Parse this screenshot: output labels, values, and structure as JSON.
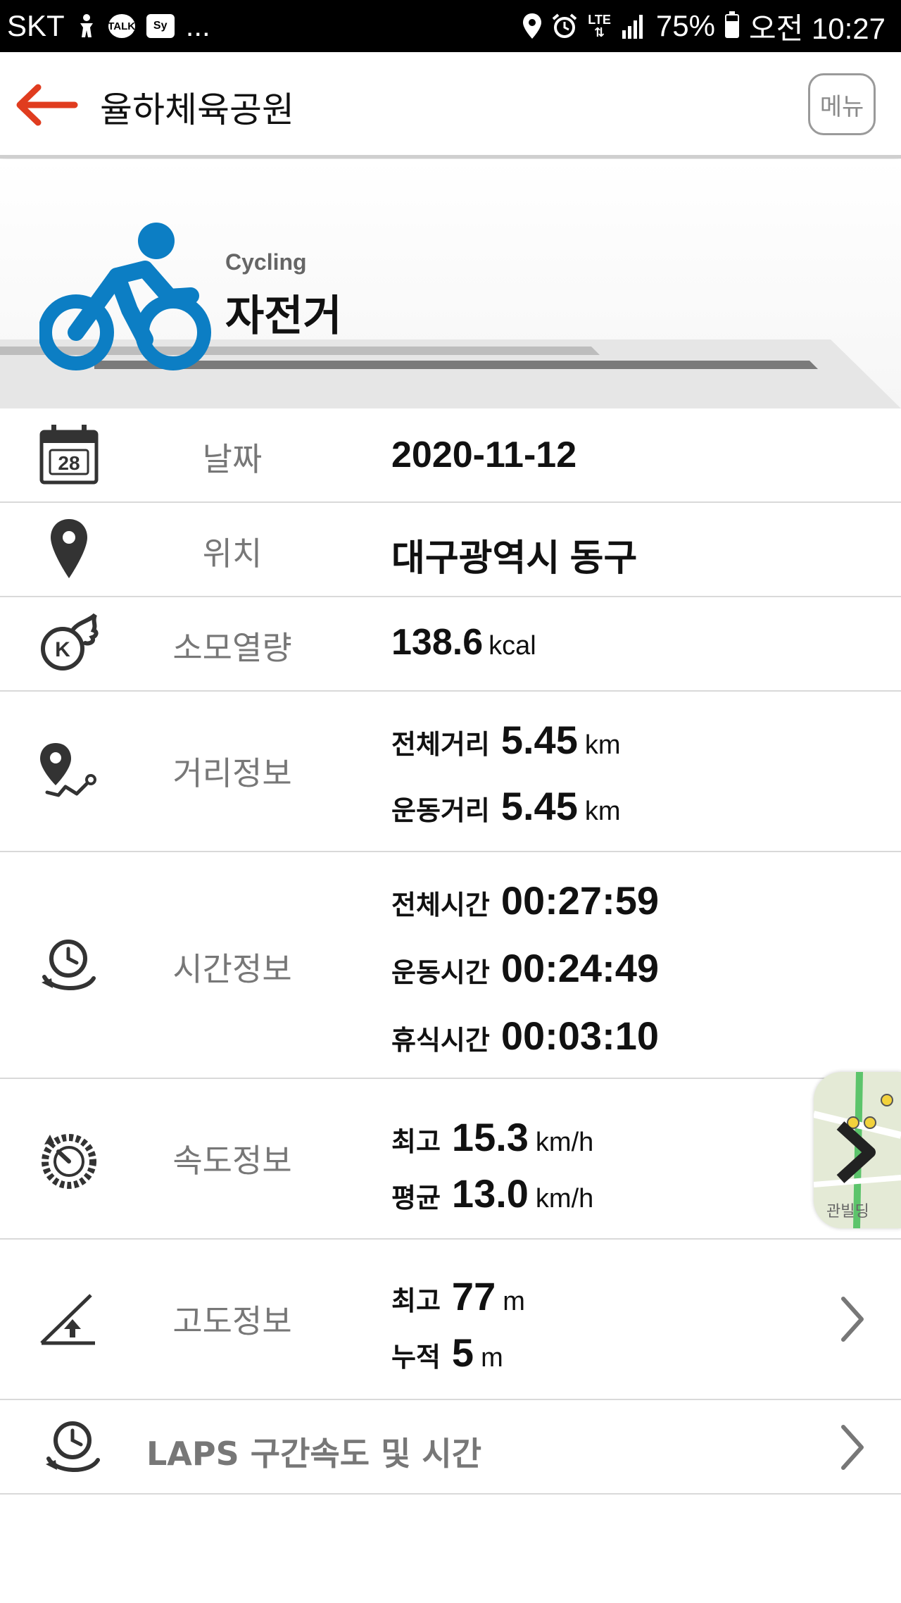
{
  "status_bar": {
    "carrier": "SKT",
    "talk_icon_label": "TALK",
    "sy_icon_label": "Sy",
    "more": "...",
    "network": "LTE",
    "battery": "75%",
    "time": "오전 10:27"
  },
  "header": {
    "title": "율하체육공원",
    "menu_label": "메뉴",
    "accent_color": "#e03c1f"
  },
  "activity": {
    "subtitle": "Cycling",
    "name": "자전거",
    "icon_color": "#0c7ec4"
  },
  "rows": {
    "date": {
      "label": "날짜",
      "value": "2020-11-12",
      "calendar_day": "28"
    },
    "location": {
      "label": "위치",
      "value": "대구광역시 동구"
    },
    "calories": {
      "label": "소모열량",
      "value": "138.6",
      "unit": "kcal",
      "icon_letter": "K"
    },
    "distance": {
      "label": "거리정보",
      "total_label": "전체거리",
      "total_value": "5.45",
      "total_unit": "km",
      "exercise_label": "운동거리",
      "exercise_value": "5.45",
      "exercise_unit": "km"
    },
    "time": {
      "label": "시간정보",
      "total_label": "전체시간",
      "total_value": "00:27:59",
      "exercise_label": "운동시간",
      "exercise_value": "00:24:49",
      "rest_label": "휴식시간",
      "rest_value": "00:03:10"
    },
    "speed": {
      "label": "속도정보",
      "max_label": "최고",
      "max_value": "15.3",
      "max_unit": "km/h",
      "avg_label": "평균",
      "avg_value": "13.0",
      "avg_unit": "km/h"
    },
    "altitude": {
      "label": "고도정보",
      "max_label": "최고",
      "max_value": "77",
      "max_unit": "m",
      "cum_label": "누적",
      "cum_value": "5",
      "cum_unit": "m"
    },
    "laps": {
      "label": "LAPS 구간속도 및 시간"
    }
  },
  "map_thumbnail": {
    "text": "관빌딩"
  }
}
